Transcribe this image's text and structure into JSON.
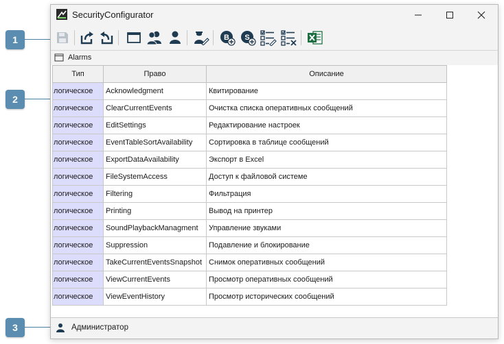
{
  "callouts": [
    "1",
    "2",
    "3"
  ],
  "window": {
    "title": "SecurityConfigurator"
  },
  "toolbar": {
    "buttons": [
      {
        "name": "save-icon"
      },
      {
        "name": "export-icon"
      },
      {
        "name": "import-icon"
      },
      {
        "name": "window-icon"
      },
      {
        "name": "users-group-icon"
      },
      {
        "name": "user-icon"
      },
      {
        "name": "user-edit-icon"
      },
      {
        "name": "add-b-icon",
        "letter": "B"
      },
      {
        "name": "add-s-icon",
        "letter": "S"
      },
      {
        "name": "checklist-edit-icon"
      },
      {
        "name": "checklist-remove-icon"
      },
      {
        "name": "excel-icon"
      }
    ]
  },
  "panel": {
    "title": "Alarms"
  },
  "table": {
    "columns": [
      "Тип",
      "Право",
      "Описание"
    ],
    "rows": [
      {
        "type": "логическое",
        "right": "Acknowledgment",
        "description": "Квитирование"
      },
      {
        "type": "логическое",
        "right": "ClearCurrentEvents",
        "description": "Очистка списка оперативных сообщений"
      },
      {
        "type": "логическое",
        "right": "EditSettings",
        "description": "Редактирование настроек"
      },
      {
        "type": "логическое",
        "right": "EventTableSortAvailability",
        "description": "Сортировка в таблице сообщений"
      },
      {
        "type": "логическое",
        "right": "ExportDataAvailability",
        "description": "Экспорт в Excel"
      },
      {
        "type": "логическое",
        "right": "FileSystemAccess",
        "description": "Доступ к файловой системе"
      },
      {
        "type": "логическое",
        "right": "Filtering",
        "description": "Фильтрация"
      },
      {
        "type": "логическое",
        "right": "Printing",
        "description": "Вывод на принтер"
      },
      {
        "type": "логическое",
        "right": "SoundPlaybackManagment",
        "description": "Управление звуками"
      },
      {
        "type": "логическое",
        "right": "Suppression",
        "description": "Подавление и блокирование"
      },
      {
        "type": "логическое",
        "right": "TakeCurrentEventsSnapshot",
        "description": "Снимок оперативных сообщений"
      },
      {
        "type": "логическое",
        "right": "ViewCurrentEvents",
        "description": "Просмотр оперативных сообщений"
      },
      {
        "type": "логическое",
        "right": "ViewEventHistory",
        "description": "Просмотр исторических сообщений"
      }
    ]
  },
  "status": {
    "user": "Администратор"
  },
  "colors": {
    "accent": "#1f3b52",
    "type_cell": "#dcdcfc",
    "callout": "#5a8db0",
    "excel": "#1d6f42"
  }
}
